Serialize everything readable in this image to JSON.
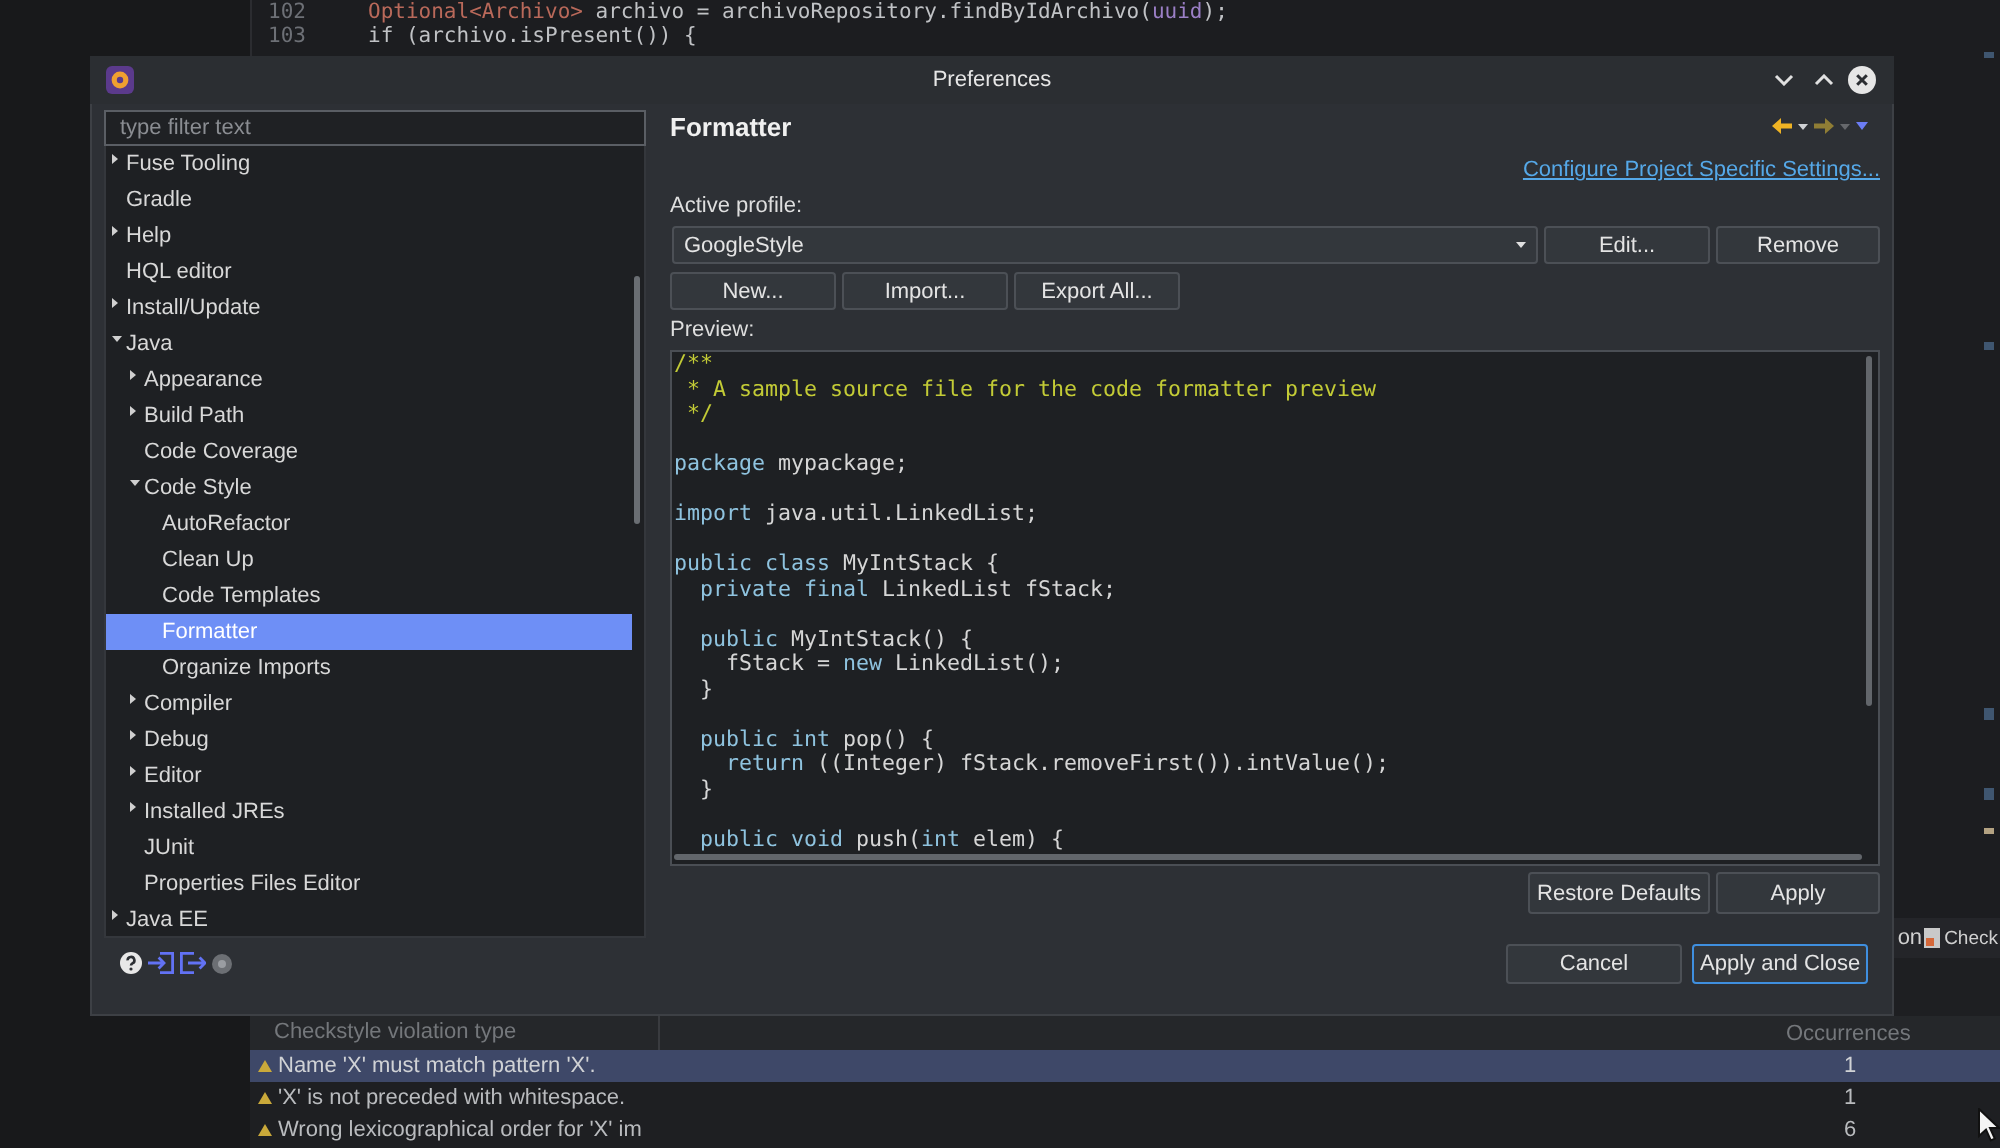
{
  "editor": {
    "lines": [
      {
        "number": "102",
        "tokens": [
          {
            "text": "Optional<Archivo>",
            "kind": "type"
          },
          {
            "text": " archivo = archivoRepository.findByIdArchivo(",
            "kind": "plain"
          },
          {
            "text": "uuid",
            "kind": "variable"
          },
          {
            "text": ");",
            "kind": "plain"
          }
        ]
      },
      {
        "number": "103",
        "tokens": [
          {
            "text": "if (archivo.isPresent()) {",
            "kind": "plain"
          }
        ]
      }
    ]
  },
  "panel": {
    "tabs": [
      {
        "label": "on",
        "has_icon": false
      },
      {
        "label": "Check",
        "has_icon": true
      }
    ],
    "columns": [
      "Checkstyle violation type",
      "Occurrences"
    ],
    "rows": [
      {
        "type": "Name 'X' must match pattern 'X'.",
        "occurrences": "1",
        "kind": "warning",
        "selected": true
      },
      {
        "type": "'X' is not preceded with whitespace.",
        "occurrences": "1",
        "kind": "warning",
        "selected": false
      },
      {
        "type": "Wrong lexicographical order for 'X' im",
        "occurrences": "6",
        "kind": "warning",
        "selected": false
      }
    ]
  },
  "window": {
    "title": "Preferences"
  },
  "filter": {
    "placeholder": "type filter text"
  },
  "tree": [
    {
      "label": "Fuse Tooling",
      "kind": "branch",
      "expanded": false,
      "selected": false
    },
    {
      "label": "Gradle",
      "kind": "leaf",
      "selected": false
    },
    {
      "label": "Help",
      "kind": "branch",
      "expanded": false,
      "selected": false
    },
    {
      "label": "HQL editor",
      "kind": "leaf",
      "selected": false
    },
    {
      "label": "Install/Update",
      "kind": "branch",
      "expanded": false,
      "selected": false
    },
    {
      "label": "Java",
      "kind": "branch",
      "expanded": true,
      "selected": false,
      "children": [
        {
          "label": "Appearance",
          "kind": "branch",
          "expanded": false,
          "selected": false
        },
        {
          "label": "Build Path",
          "kind": "branch",
          "expanded": false,
          "selected": false
        },
        {
          "label": "Code Coverage",
          "kind": "leaf",
          "selected": false
        },
        {
          "label": "Code Style",
          "kind": "branch",
          "expanded": true,
          "selected": false,
          "children": [
            {
              "label": "AutoRefactor",
              "kind": "leaf",
              "selected": false
            },
            {
              "label": "Clean Up",
              "kind": "leaf",
              "selected": false
            },
            {
              "label": "Code Templates",
              "kind": "leaf",
              "selected": false
            },
            {
              "label": "Formatter",
              "kind": "leaf",
              "selected": true
            },
            {
              "label": "Organize Imports",
              "kind": "leaf",
              "selected": false
            }
          ]
        },
        {
          "label": "Compiler",
          "kind": "branch",
          "expanded": false,
          "selected": false
        },
        {
          "label": "Debug",
          "kind": "branch",
          "expanded": false,
          "selected": false
        },
        {
          "label": "Editor",
          "kind": "branch",
          "expanded": false,
          "selected": false
        },
        {
          "label": "Installed JREs",
          "kind": "branch",
          "expanded": false,
          "selected": false
        },
        {
          "label": "JUnit",
          "kind": "leaf",
          "selected": false
        },
        {
          "label": "Properties Files Editor",
          "kind": "leaf",
          "selected": false
        }
      ]
    },
    {
      "label": "Java EE",
      "kind": "branch",
      "expanded": false,
      "selected": false
    }
  ],
  "page": {
    "title": "Formatter",
    "navigation": [
      {
        "kind": "back",
        "disabled": false
      },
      {
        "kind": "forward",
        "disabled": true
      }
    ],
    "link": "Configure Project Specific Settings...",
    "profile_label": "Active profile:",
    "profile": "GoogleStyle",
    "profile_buttons": [
      "Edit...",
      "Remove"
    ],
    "profile_actions": [
      "New...",
      "Import...",
      "Export All..."
    ],
    "preview_label": "Preview:",
    "preview": [
      {
        "kind": "code",
        "tokens": [
          {
            "text": "/**",
            "kind": "comment"
          }
        ]
      },
      {
        "kind": "code",
        "tokens": [
          {
            "text": " * A sample source file for the code formatter preview",
            "kind": "comment"
          }
        ]
      },
      {
        "kind": "code",
        "tokens": [
          {
            "text": " */",
            "kind": "comment"
          }
        ]
      },
      {
        "kind": "blank"
      },
      {
        "kind": "code",
        "tokens": [
          {
            "text": "package",
            "kind": "keyword"
          },
          {
            "text": " mypackage;",
            "kind": "plain"
          }
        ]
      },
      {
        "kind": "blank"
      },
      {
        "kind": "code",
        "tokens": [
          {
            "text": "import",
            "kind": "keyword"
          },
          {
            "text": " java.util.LinkedList;",
            "kind": "plain"
          }
        ]
      },
      {
        "kind": "blank"
      },
      {
        "kind": "code",
        "tokens": [
          {
            "text": "public class",
            "kind": "keyword"
          },
          {
            "text": " MyIntStack {",
            "kind": "plain"
          }
        ]
      },
      {
        "kind": "code",
        "tokens": [
          {
            "text": "  private final",
            "kind": "keyword"
          },
          {
            "text": " LinkedList fStack;",
            "kind": "plain"
          }
        ]
      },
      {
        "kind": "blank"
      },
      {
        "kind": "code",
        "tokens": [
          {
            "text": "  public",
            "kind": "keyword"
          },
          {
            "text": " MyIntStack() {",
            "kind": "plain"
          }
        ]
      },
      {
        "kind": "code",
        "tokens": [
          {
            "text": "    fStack = ",
            "kind": "plain"
          },
          {
            "text": "new",
            "kind": "keyword"
          },
          {
            "text": " LinkedList();",
            "kind": "plain"
          }
        ]
      },
      {
        "kind": "code",
        "tokens": [
          {
            "text": "  }",
            "kind": "plain"
          }
        ]
      },
      {
        "kind": "blank"
      },
      {
        "kind": "code",
        "tokens": [
          {
            "text": "  public int",
            "kind": "keyword"
          },
          {
            "text": " pop() {",
            "kind": "plain"
          }
        ]
      },
      {
        "kind": "code",
        "tokens": [
          {
            "text": "    return",
            "kind": "keyword"
          },
          {
            "text": " ((Integer) fStack.removeFirst()).intValue();",
            "kind": "plain"
          }
        ]
      },
      {
        "kind": "code",
        "tokens": [
          {
            "text": "  }",
            "kind": "plain"
          }
        ]
      },
      {
        "kind": "blank"
      },
      {
        "kind": "code",
        "tokens": [
          {
            "text": "  public void",
            "kind": "keyword"
          },
          {
            "text": " push(",
            "kind": "plain"
          },
          {
            "text": "int",
            "kind": "keyword"
          },
          {
            "text": " elem) {",
            "kind": "plain"
          }
        ]
      }
    ],
    "page_buttons": [
      "Restore Defaults",
      "Apply"
    ]
  },
  "buttons": [
    {
      "label": "Cancel",
      "default": false
    },
    {
      "label": "Apply and Close",
      "default": true
    }
  ]
}
